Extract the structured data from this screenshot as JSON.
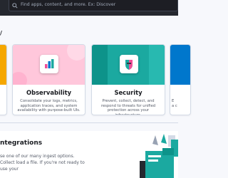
{
  "header": {
    "search": {
      "placeholder": "Find apps, content, and more. Ex: Discover",
      "icon": "search-icon"
    }
  },
  "page": {
    "section_heading_fragment": "/"
  },
  "solutions": [
    {
      "id": "left-partial",
      "banner_color": "#f5a700",
      "title": "",
      "description": ""
    },
    {
      "id": "observability",
      "banner_color": "#ffc7db",
      "title": "Observability",
      "description": "Consolidate your logs, metrics, application traces, and system availability with purpose-built UIs.",
      "icon": "observability-logo-icon"
    },
    {
      "id": "security",
      "banner_color": "#1ba9a0",
      "title": "Security",
      "description": "Prevent, collect, detect, and respond to threats for unified protection across your infrastructure.",
      "icon": "security-logo-icon"
    },
    {
      "id": "right-partial",
      "banner_color": "#0077cc",
      "title": "",
      "description": "E a c"
    }
  ],
  "integrations": {
    "title": "ntegrations",
    "description": "se one of our many ingest options. Collect load a file. If you're not ready to use your"
  },
  "colors": {
    "topbar": "#25282f",
    "page_bg": "#f7f8fc",
    "accent_teal": "#1ba9a0",
    "accent_pink": "#f04e98"
  }
}
